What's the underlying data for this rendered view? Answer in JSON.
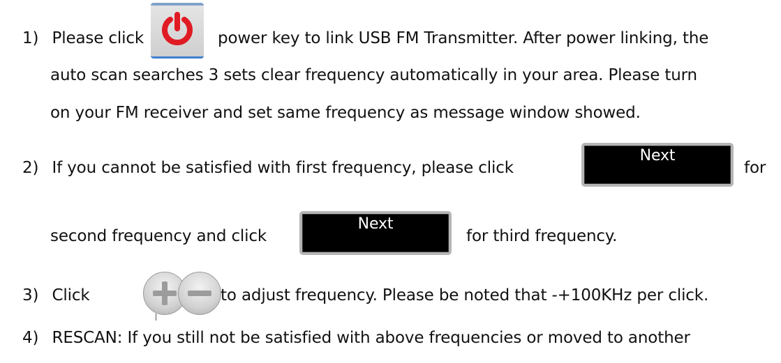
{
  "steps": [
    {
      "number": "1)",
      "lines": [
        {
          "before": "Please click",
          "after": "power key to link USB FM Transmitter. After power linking, the"
        },
        {
          "text": "auto scan searches 3 sets clear frequency automatically in your area. Please turn"
        },
        {
          "text": "on your FM receiver and set same frequency as message window showed."
        }
      ]
    },
    {
      "number": "2)",
      "lines": [
        {
          "before": "If you cannot be satisfied with first frequency, please click",
          "after": "for"
        },
        {
          "before": "second frequency and click",
          "after": "for third frequency."
        }
      ]
    },
    {
      "number": "3)",
      "lines": [
        {
          "before": "Click",
          "after": "to adjust frequency. Please be noted that -+100KHz per click."
        }
      ]
    },
    {
      "number": "4)",
      "lines": [
        {
          "text": "RESCAN: If you still not be satisfied with above frequencies or moved to another"
        }
      ]
    }
  ],
  "buttons": {
    "next_label": "Next"
  },
  "icons": {
    "power": "power-icon",
    "plus": "plus-icon",
    "minus": "minus-icon"
  },
  "colors": {
    "power_red": "#e01b24",
    "next_bg": "#000000",
    "text": "#111111"
  }
}
